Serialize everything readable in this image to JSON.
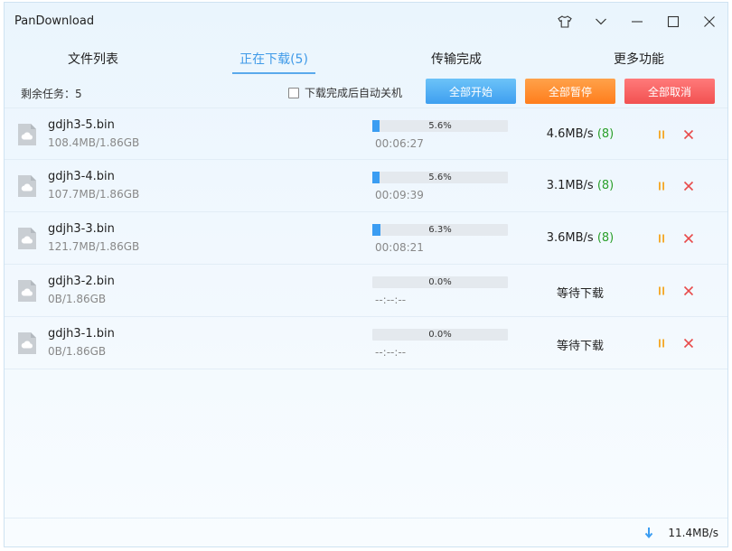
{
  "app": {
    "title": "PanDownload"
  },
  "tabs": [
    {
      "label": "文件列表",
      "active": false
    },
    {
      "label": "正在下载(5)",
      "active": true
    },
    {
      "label": "传输完成",
      "active": false
    },
    {
      "label": "更多功能",
      "active": false
    }
  ],
  "toolbar": {
    "remaining": "剩余任务：5",
    "auto_shutdown_label": "下载完成后自动关机",
    "auto_shutdown_checked": false,
    "start_all": "全部开始",
    "pause_all": "全部暂停",
    "cancel_all": "全部取消"
  },
  "downloads": [
    {
      "name": "gdjh3-5.bin",
      "size": "108.4MB/1.86GB",
      "progress": 5.6,
      "progress_label": "5.6%",
      "eta": "00:06:27",
      "speed": "4.6MB/s",
      "connections": "(8)",
      "status": ""
    },
    {
      "name": "gdjh3-4.bin",
      "size": "107.7MB/1.86GB",
      "progress": 5.6,
      "progress_label": "5.6%",
      "eta": "00:09:39",
      "speed": "3.1MB/s",
      "connections": "(8)",
      "status": ""
    },
    {
      "name": "gdjh3-3.bin",
      "size": "121.7MB/1.86GB",
      "progress": 6.3,
      "progress_label": "6.3%",
      "eta": "00:08:21",
      "speed": "3.6MB/s",
      "connections": "(8)",
      "status": ""
    },
    {
      "name": "gdjh3-2.bin",
      "size": "0B/1.86GB",
      "progress": 0,
      "progress_label": "0.0%",
      "eta": "--:--:--",
      "speed": "",
      "connections": "",
      "status": "等待下载"
    },
    {
      "name": "gdjh3-1.bin",
      "size": "0B/1.86GB",
      "progress": 0,
      "progress_label": "0.0%",
      "eta": "--:--:--",
      "speed": "",
      "connections": "",
      "status": "等待下载"
    }
  ],
  "statusbar": {
    "total_speed": "11.4MB/s"
  },
  "colors": {
    "accent": "#3f9ae8",
    "progress": "#3b9df2",
    "start": "#4aa8f2",
    "pause": "#ff8a2a",
    "cancel": "#f45c5c",
    "connections": "#2ca02c",
    "pause_icon": "#f5a623",
    "close_icon": "#e84a4a"
  },
  "icons": {
    "skin": "tshirt-icon",
    "menu": "chevron-down-icon",
    "minimize": "minimize-icon",
    "maximize": "maximize-icon",
    "close": "close-icon",
    "file": "cloud-file-icon",
    "pause": "pause-icon",
    "cancel": "x-icon",
    "download": "download-arrow-icon"
  }
}
